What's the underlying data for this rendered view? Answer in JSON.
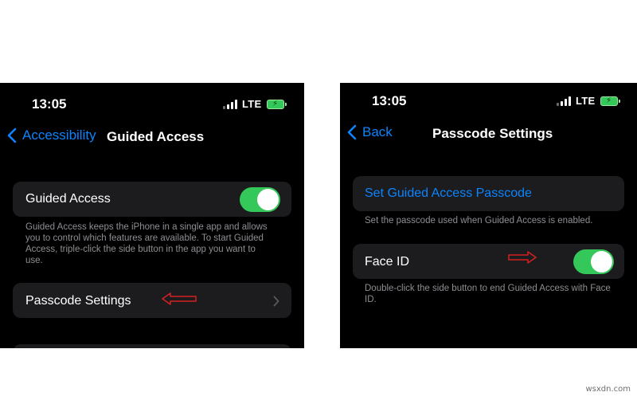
{
  "left_phone": {
    "status": {
      "time": "13:05",
      "network": "LTE"
    },
    "nav": {
      "back_label": "Accessibility",
      "title": "Guided Access"
    },
    "guided_access_row": {
      "label": "Guided Access",
      "toggle_on": true
    },
    "guided_access_footer": "Guided Access keeps the iPhone in a single app and allows you to control which features are available. To start Guided Access, triple-click the side button in the app you want to use.",
    "passcode_row": {
      "label": "Passcode Settings"
    }
  },
  "right_phone": {
    "status": {
      "time": "13:05",
      "network": "LTE"
    },
    "nav": {
      "back_label": "Back",
      "title": "Passcode Settings"
    },
    "set_passcode_row": {
      "label": "Set Guided Access Passcode"
    },
    "set_passcode_footer": "Set the passcode used when Guided Access is enabled.",
    "face_id_row": {
      "label": "Face ID",
      "toggle_on": true
    },
    "face_id_footer": "Double-click the side button to end Guided Access with Face ID."
  },
  "annotations": {
    "arrow_color": "#d42020"
  },
  "watermark": "wsxdn.com",
  "colors": {
    "accent": "#0a84ff",
    "toggle_on": "#34c759",
    "cell": "#1c1c1e",
    "secondary_text": "#8e8e93"
  }
}
